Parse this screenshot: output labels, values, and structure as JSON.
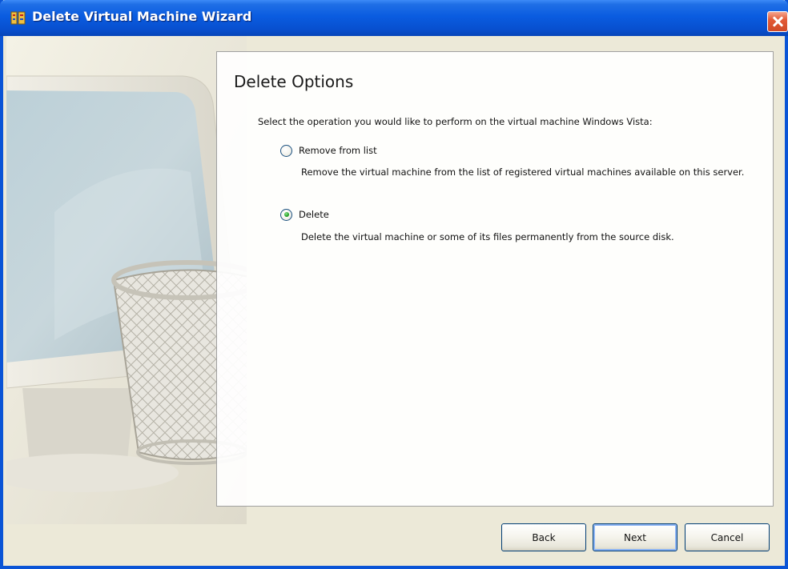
{
  "window": {
    "title": "Delete Virtual Machine Wizard",
    "title_icon": "vm-wizard-icon",
    "close_icon": "close-icon"
  },
  "page": {
    "heading": "Delete Options",
    "instruction": "Select the operation you would like to perform on the virtual machine Windows Vista:",
    "options": [
      {
        "label": "Remove from list",
        "description": "Remove the virtual machine from the list of registered virtual machines available on this server.",
        "selected": false
      },
      {
        "label": "Delete",
        "description": "Delete the virtual machine or some of its files permanently from the source disk.",
        "selected": true
      }
    ]
  },
  "buttons": {
    "back": "Back",
    "next": "Next",
    "cancel": "Cancel"
  },
  "colors": {
    "titlebar": "#0a5ce0",
    "selected_radio": "#22a022",
    "close_button": "#e35a36"
  }
}
